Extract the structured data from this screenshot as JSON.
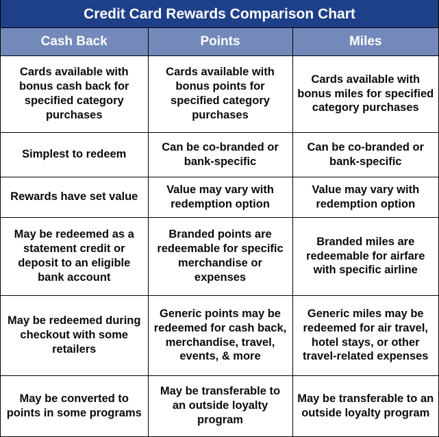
{
  "title": "Credit Card Rewards Comparison Chart",
  "colors": {
    "title_bar": "#1E4089",
    "column_header": "#7289BA",
    "header_text": "#FFFFFF",
    "cell_text": "#0A0A0A",
    "border": "#000000",
    "cell_background": "#FFFFFF"
  },
  "columns": [
    {
      "label": "Cash Back"
    },
    {
      "label": "Points"
    },
    {
      "label": "Miles"
    }
  ],
  "rows": [
    {
      "cash_back": "Cards available with bonus cash back for specified category purchases",
      "points": "Cards available with bonus points for specified category purchases",
      "miles": "Cards available with bonus miles for specified category purchases"
    },
    {
      "cash_back": "Simplest to redeem",
      "points": "Can be co-branded or bank-specific",
      "miles": "Can be co-branded or bank-specific"
    },
    {
      "cash_back": "Rewards have set value",
      "points": "Value may vary with redemption option",
      "miles": "Value may vary with redemption option"
    },
    {
      "cash_back": "May be redeemed as a statement credit or deposit to an eligible bank account",
      "points": "Branded points are redeemable for specific merchandise or expenses",
      "miles": "Branded miles are redeemable for airfare with specific airline"
    },
    {
      "cash_back": "May be redeemed during checkout with some retailers",
      "points": "Generic points may be redeemed for cash back, merchandise, travel, events, & more",
      "miles": "Generic miles may be redeemed for air travel, hotel stays, or other travel-related expenses"
    },
    {
      "cash_back": "May be converted to points in some programs",
      "points": "May be transferable to an outside loyalty program",
      "miles": "May be transferable to an outside loyalty program"
    }
  ],
  "chart_data": {
    "type": "table",
    "title": "Credit Card Rewards Comparison Chart",
    "columns": [
      "Cash Back",
      "Points",
      "Miles"
    ],
    "rows": [
      [
        "Cards available with bonus cash back for specified category purchases",
        "Cards available with bonus points for specified category purchases",
        "Cards available with bonus miles for specified category purchases"
      ],
      [
        "Simplest to redeem",
        "Can be co-branded or bank-specific",
        "Can be co-branded or bank-specific"
      ],
      [
        "Rewards have set value",
        "Value may vary with redemption option",
        "Value may vary with redemption option"
      ],
      [
        "May be redeemed as a statement credit or deposit to an eligible bank account",
        "Branded points are redeemable for specific merchandise or expenses",
        "Branded miles are redeemable for airfare with specific airline"
      ],
      [
        "May be redeemed during checkout with some retailers",
        "Generic points may be redeemed for cash back, merchandise, travel, events, & more",
        "Generic miles may be redeemed for air travel, hotel stays, or other travel-related expenses"
      ],
      [
        "May be converted to points in some programs",
        "May be transferable to an outside loyalty program",
        "May be transferable to an outside loyalty program"
      ]
    ]
  }
}
